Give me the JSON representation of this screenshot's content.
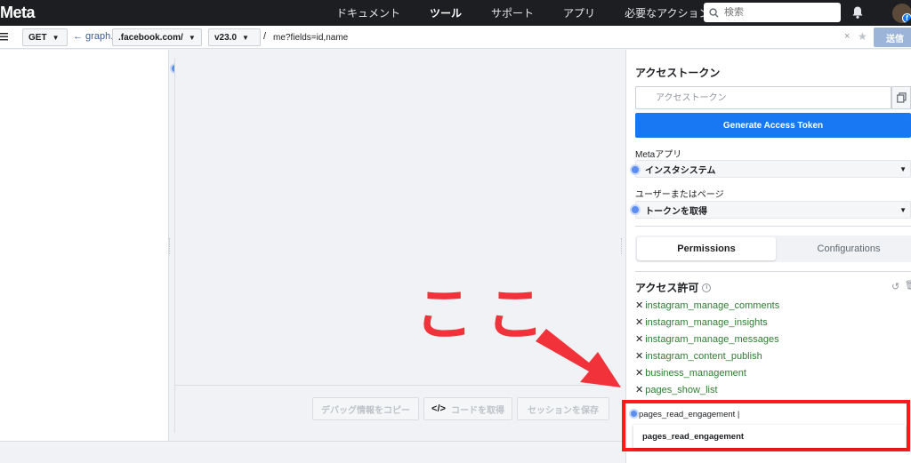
{
  "topnav": {
    "logo": "Meta",
    "links": [
      "ドキュメント",
      "ツール",
      "サポート",
      "アプリ",
      "必要なアクション"
    ],
    "active_link": "ツール",
    "search_placeholder": "検索"
  },
  "querybar": {
    "method": "GET",
    "graph_link": "← graph.",
    "domain": ".facebook.com/",
    "version": "v23.0",
    "slash": "/",
    "path": "me?fields=id,name",
    "clear": "×",
    "star": "★",
    "submit_label": "送信"
  },
  "bottom_buttons": {
    "copy_debug": "デバッグ情報をコピー",
    "code_icon": "</>",
    "get_code": "コードを取得",
    "save_session": "セッションを保存"
  },
  "annotation": {
    "text": "ここ",
    "arrow_color": "#f1323a"
  },
  "right_panel": {
    "title": "アクセストークン",
    "token_placeholder": "アクセストークン",
    "generate_label": "Generate Access Token",
    "meta_app_label": "Metaアプリ",
    "meta_app_value": "インスタシステム",
    "user_page_label": "ユーザーまたはページ",
    "user_page_value": "トークンを取得",
    "tabs": [
      "Permissions",
      "Configurations"
    ],
    "permissions_title": "アクセス許可",
    "info_icon": "i",
    "undo_icon": "↺",
    "trash_icon": "🗑",
    "permissions": [
      "instagram_manage_comments",
      "instagram_manage_insights",
      "instagram_manage_messages",
      "instagram_content_publish",
      "business_management",
      "pages_show_list"
    ],
    "remove_icon": "✕",
    "permission_input_value": "pages_read_engagement |",
    "suggestion": "pages_read_engagement"
  },
  "colors": {
    "accent": "#1877f2",
    "permission_green": "#2e7d32",
    "highlight_red": "#ff1a1a"
  }
}
